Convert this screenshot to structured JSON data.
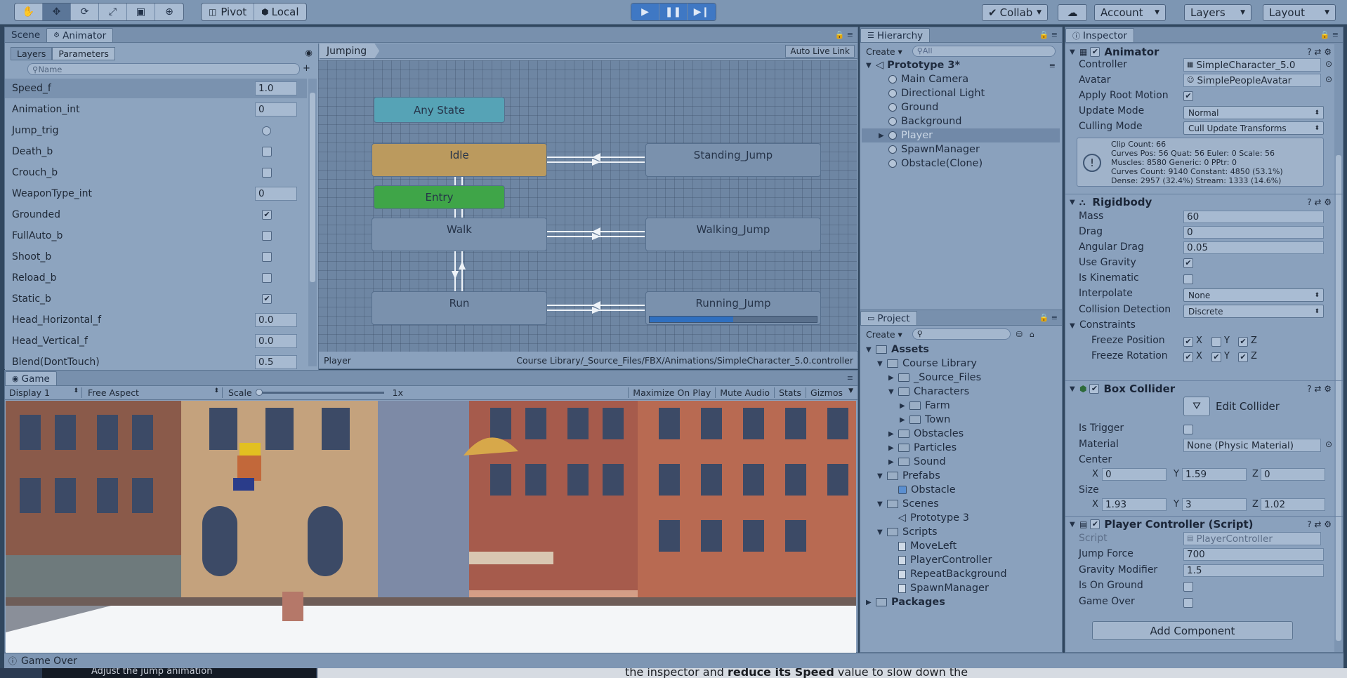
{
  "toolbar": {
    "pivot": "Pivot",
    "local": "Local",
    "collab": "Collab",
    "account": "Account",
    "layers": "Layers",
    "layout": "Layout"
  },
  "scene_tabs": {
    "scene": "Scene",
    "animator": "Animator"
  },
  "animator": {
    "subtabs": {
      "layers": "Layers",
      "parameters": "Parameters"
    },
    "search_placeholder": "Name",
    "breadcrumb": "Jumping",
    "auto_live_link": "Auto Live Link",
    "footer_object": "Player",
    "footer_path": "Course Library/_Source_Files/FBX/Animations/SimpleCharacter_5.0.controller",
    "parameters": [
      {
        "name": "Speed_f",
        "type": "float",
        "value": "1.0"
      },
      {
        "name": "Animation_int",
        "type": "int",
        "value": "0"
      },
      {
        "name": "Jump_trig",
        "type": "trigger",
        "value": ""
      },
      {
        "name": "Death_b",
        "type": "bool",
        "value": ""
      },
      {
        "name": "Crouch_b",
        "type": "bool",
        "value": ""
      },
      {
        "name": "WeaponType_int",
        "type": "int",
        "value": "0"
      },
      {
        "name": "Grounded",
        "type": "bool",
        "value": "✔"
      },
      {
        "name": "FullAuto_b",
        "type": "bool",
        "value": ""
      },
      {
        "name": "Shoot_b",
        "type": "bool",
        "value": ""
      },
      {
        "name": "Reload_b",
        "type": "bool",
        "value": ""
      },
      {
        "name": "Static_b",
        "type": "bool",
        "value": "✔"
      },
      {
        "name": "Head_Horizontal_f",
        "type": "float",
        "value": "0.0"
      },
      {
        "name": "Head_Vertical_f",
        "type": "float",
        "value": "0.0"
      },
      {
        "name": "Blend(DontTouch)",
        "type": "float",
        "value": "0.5"
      }
    ],
    "states": {
      "any": "Any State",
      "idle": "Idle",
      "entry": "Entry",
      "walk": "Walk",
      "run": "Run",
      "standing_jump": "Standing_Jump",
      "walking_jump": "Walking_Jump",
      "running_jump": "Running_Jump"
    },
    "running_jump_progress": 0.5
  },
  "hierarchy": {
    "title": "Hierarchy",
    "create": "Create",
    "search_placeholder": "All",
    "scene": "Prototype 3*",
    "items": [
      "Main Camera",
      "Directional Light",
      "Ground",
      "Background",
      "Player",
      "SpawnManager",
      "Obstacle(Clone)"
    ]
  },
  "project": {
    "title": "Project",
    "create": "Create",
    "tree": [
      "Assets",
      "Course Library",
      "_Source_Files",
      "Characters",
      "Farm",
      "Town",
      "Obstacles",
      "Particles",
      "Sound",
      "Prefabs",
      "Obstacle",
      "Scenes",
      "Prototype 3",
      "Scripts",
      "MoveLeft",
      "PlayerController",
      "RepeatBackground",
      "SpawnManager",
      "Packages"
    ]
  },
  "inspector": {
    "title": "Inspector",
    "animator": {
      "header": "Animator",
      "controller_label": "Controller",
      "controller": "SimpleCharacter_5.0",
      "avatar_label": "Avatar",
      "avatar": "SimplePeopleAvatar",
      "root_motion_label": "Apply Root Motion",
      "update_mode_label": "Update Mode",
      "update_mode": "Normal",
      "culling_label": "Culling Mode",
      "culling": "Cull Update Transforms",
      "info": [
        "Clip Count: 66",
        "Curves Pos: 56 Quat: 56 Euler: 0 Scale: 56",
        "Muscles: 8580 Generic: 0 PPtr: 0",
        "Curves Count: 9140 Constant: 4850 (53.1%)",
        "Dense: 2957 (32.4%) Stream: 1333 (14.6%)"
      ]
    },
    "rigidbody": {
      "header": "Rigidbody",
      "mass_label": "Mass",
      "mass": "60",
      "drag_label": "Drag",
      "drag": "0",
      "angular_label": "Angular Drag",
      "angular": "0.05",
      "gravity_label": "Use Gravity",
      "kinematic_label": "Is Kinematic",
      "interpolate_label": "Interpolate",
      "interpolate": "None",
      "collision_label": "Collision Detection",
      "collision": "Discrete",
      "constraints_label": "Constraints",
      "freeze_pos_label": "Freeze Position",
      "freeze_rot_label": "Freeze Rotation",
      "x": "X",
      "y": "Y",
      "z": "Z"
    },
    "box": {
      "header": "Box Collider",
      "edit": "Edit Collider",
      "trigger_label": "Is Trigger",
      "material_label": "Material",
      "material": "None (Physic Material)",
      "center_label": "Center",
      "cx": "0",
      "cy": "1.59",
      "cz": "0",
      "size_label": "Size",
      "sx": "1.93",
      "sy": "3",
      "sz": "1.02"
    },
    "player": {
      "header": "Player Controller (Script)",
      "script_label": "Script",
      "script": "PlayerController",
      "jump_label": "Jump Force",
      "jump": "700",
      "gravity_label": "Gravity Modifier",
      "gravity": "1.5",
      "ground_label": "Is On Ground",
      "over_label": "Game Over"
    },
    "add_component": "Add Component"
  },
  "game": {
    "tab": "Game",
    "display": "Display 1",
    "aspect": "Free Aspect",
    "scale_label": "Scale",
    "scale_value": "1x",
    "maximize": "Maximize On Play",
    "mute": "Mute Audio",
    "stats": "Stats",
    "gizmos": "Gizmos"
  },
  "status": "Game Over",
  "below_text": {
    "left": "Adjust the jump animation",
    "right_a": "the inspector and ",
    "right_b": "reduce its Speed",
    "right_c": " value to slow down the"
  },
  "colors": {
    "idle": "#bb9a5e",
    "entry": "#3fa548",
    "any": "#56a3b6",
    "node": "#7a91ad",
    "accent": "#2f6fbf"
  }
}
